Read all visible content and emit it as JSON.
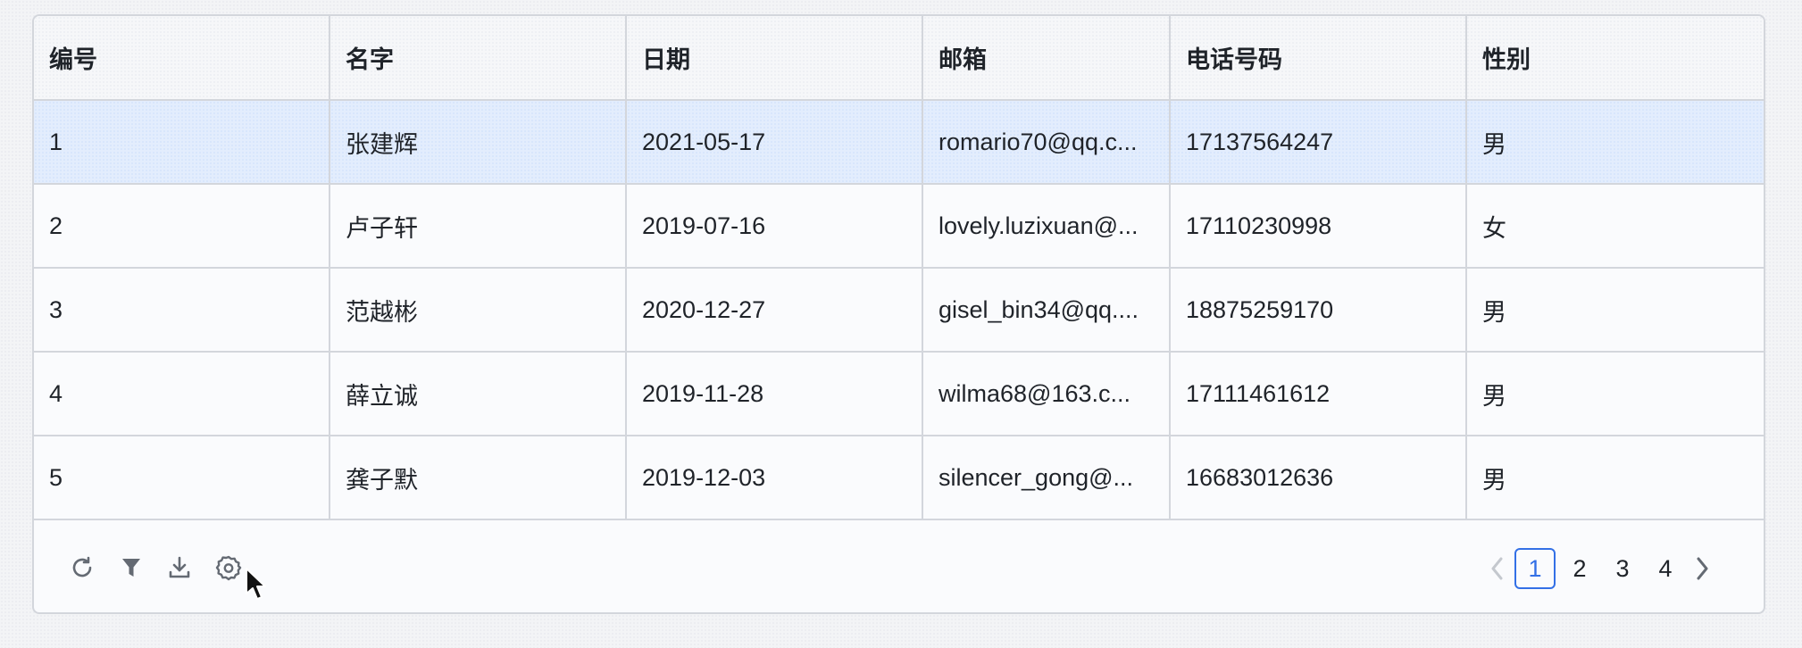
{
  "table": {
    "columns": [
      "编号",
      "名字",
      "日期",
      "邮箱",
      "电话号码",
      "性别"
    ],
    "rows": [
      [
        "1",
        "张建辉",
        "2021-05-17",
        "romario70@qq.c...",
        "17137564247",
        "男"
      ],
      [
        "2",
        "卢子轩",
        "2019-07-16",
        "lovely.luzixuan@...",
        "17110230998",
        "女"
      ],
      [
        "3",
        "范越彬",
        "2020-12-27",
        "gisel_bin34@qq....",
        "18875259170",
        "男"
      ],
      [
        "4",
        "薛立诚",
        "2019-11-28",
        "wilma68@163.c...",
        "17111461612",
        "男"
      ],
      [
        "5",
        "龚子默",
        "2019-12-03",
        "silencer_gong@...",
        "16683012636",
        "男"
      ]
    ],
    "selected_row": 0
  },
  "toolbar": {
    "icons": [
      "refresh-icon",
      "filter-icon",
      "download-icon",
      "settings-icon"
    ]
  },
  "pagination": {
    "pages": [
      "1",
      "2",
      "3",
      "4"
    ],
    "current": "1"
  },
  "colors": {
    "accent": "#3370e6",
    "selected_row": "#e3edfd",
    "border": "#d3d6dc",
    "icon": "#646a73"
  }
}
